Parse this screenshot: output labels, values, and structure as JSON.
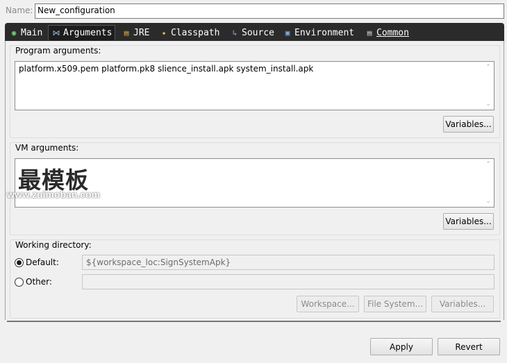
{
  "name_row": {
    "label": "Name:",
    "value": "New_configuration"
  },
  "tabs": [
    {
      "label": "Main",
      "icon": "main-class-icon"
    },
    {
      "label": "Arguments",
      "icon": "arguments-icon",
      "active": true
    },
    {
      "label": "JRE",
      "icon": "jre-library-icon"
    },
    {
      "label": "Classpath",
      "icon": "classpath-icon"
    },
    {
      "label": "Source",
      "icon": "source-icon"
    },
    {
      "label": "Environment",
      "icon": "environment-icon"
    },
    {
      "label": "Common",
      "icon": "common-icon"
    }
  ],
  "program_arguments": {
    "title": "Program arguments:",
    "value": "platform.x509.pem platform.pk8 slience_install.apk system_install.apk",
    "variables_button": "Variables..."
  },
  "vm_arguments": {
    "title": "VM arguments:",
    "value": "",
    "variables_button": "Variables..."
  },
  "watermark": {
    "text": "最模板",
    "url": "www.zuimoban.com"
  },
  "working_directory": {
    "title": "Working directory:",
    "default_label": "Default:",
    "default_value": "${workspace_loc:SignSystemApk}",
    "other_label": "Other:",
    "other_value": "",
    "selected": "default",
    "workspace_button": "Workspace...",
    "file_system_button": "File System...",
    "variables_button": "Variables..."
  },
  "footer": {
    "apply_button": "Apply",
    "revert_button": "Revert"
  }
}
